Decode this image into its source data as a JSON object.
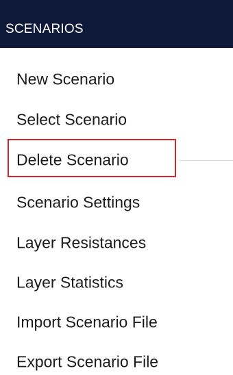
{
  "menu": {
    "header": "SCENARIOS",
    "items": [
      {
        "label": "New Scenario"
      },
      {
        "label": "Select Scenario"
      },
      {
        "label": "Delete Scenario",
        "highlighted": true
      },
      {
        "label": "Scenario Settings"
      },
      {
        "label": "Layer Resistances"
      },
      {
        "label": "Layer Statistics"
      },
      {
        "label": "Import Scenario File"
      },
      {
        "label": "Export Scenario File"
      }
    ],
    "colors": {
      "header_background": "#0f1a3a",
      "header_text": "#ffffff",
      "item_text": "#1b1b1b",
      "highlight_border": "#d3262b",
      "divider": "#d9d9d9"
    }
  }
}
